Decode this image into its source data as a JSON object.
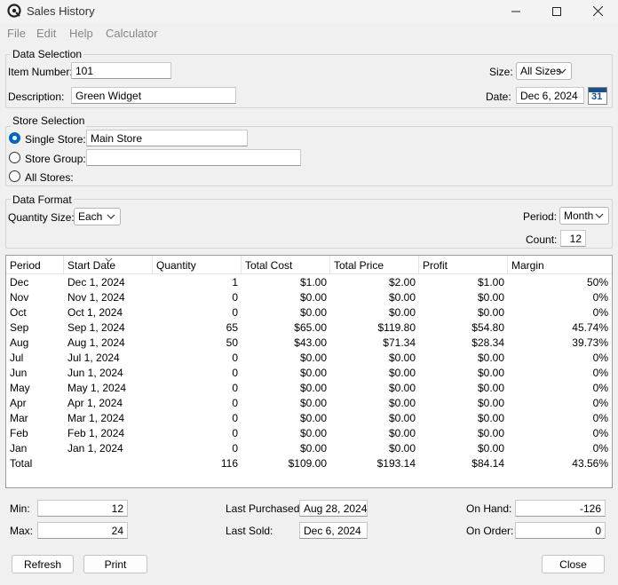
{
  "window": {
    "title": "Sales History",
    "minimize_icon": "minimize-icon",
    "maximize_icon": "maximize-icon",
    "close_icon": "close-icon"
  },
  "menu": [
    "File",
    "Edit",
    "Help",
    "Calculator"
  ],
  "data_selection": {
    "title": "Data Selection",
    "item_number_label": "Item Number:",
    "item_number": "101",
    "description_label": "Description:",
    "description": "Green Widget",
    "size_label": "Size:",
    "size": "All Sizes",
    "date_label": "Date:",
    "date": "Dec 6, 2024",
    "calendar_icon_text": "31"
  },
  "store_selection": {
    "title": "Store Selection",
    "single_store_label": "Single Store:",
    "single_store": "Main Store",
    "store_group_label": "Store Group:",
    "store_group": "",
    "all_stores_label": "All Stores:",
    "selected": "single"
  },
  "data_format": {
    "title": "Data Format",
    "quantity_size_label": "Quantity Size:",
    "quantity_size": "Each",
    "period_label": "Period:",
    "period": "Month",
    "count_label": "Count:",
    "count": "12"
  },
  "table": {
    "columns": [
      "Period",
      "Start Date",
      "Quantity",
      "Total Cost",
      "Total Price",
      "Profit",
      "Margin"
    ],
    "rows": [
      [
        "Dec",
        "Dec 1, 2024",
        "1",
        "$1.00",
        "$2.00",
        "$1.00",
        "50%"
      ],
      [
        "Nov",
        "Nov 1, 2024",
        "0",
        "$0.00",
        "$0.00",
        "$0.00",
        "0%"
      ],
      [
        "Oct",
        "Oct 1, 2024",
        "0",
        "$0.00",
        "$0.00",
        "$0.00",
        "0%"
      ],
      [
        "Sep",
        "Sep 1, 2024",
        "65",
        "$65.00",
        "$119.80",
        "$54.80",
        "45.74%"
      ],
      [
        "Aug",
        "Aug 1, 2024",
        "50",
        "$43.00",
        "$71.34",
        "$28.34",
        "39.73%"
      ],
      [
        "Jul",
        "Jul 1, 2024",
        "0",
        "$0.00",
        "$0.00",
        "$0.00",
        "0%"
      ],
      [
        "Jun",
        "Jun 1, 2024",
        "0",
        "$0.00",
        "$0.00",
        "$0.00",
        "0%"
      ],
      [
        "May",
        "May 1, 2024",
        "0",
        "$0.00",
        "$0.00",
        "$0.00",
        "0%"
      ],
      [
        "Apr",
        "Apr 1, 2024",
        "0",
        "$0.00",
        "$0.00",
        "$0.00",
        "0%"
      ],
      [
        "Mar",
        "Mar 1, 2024",
        "0",
        "$0.00",
        "$0.00",
        "$0.00",
        "0%"
      ],
      [
        "Feb",
        "Feb 1, 2024",
        "0",
        "$0.00",
        "$0.00",
        "$0.00",
        "0%"
      ],
      [
        "Jan",
        "Jan 1, 2024",
        "0",
        "$0.00",
        "$0.00",
        "$0.00",
        "0%"
      ],
      [
        "Total",
        "",
        "116",
        "$109.00",
        "$193.14",
        "$84.14",
        "43.56%"
      ]
    ]
  },
  "summary": {
    "min_label": "Min:",
    "min": "12",
    "max_label": "Max:",
    "max": "24",
    "last_purchased_label": "Last Purchased:",
    "last_purchased": "Aug 28, 2024",
    "last_sold_label": "Last Sold:",
    "last_sold": "Dec 6, 2024",
    "on_hand_label": "On Hand:",
    "on_hand": "-126",
    "on_order_label": "On Order:",
    "on_order": "0"
  },
  "buttons": {
    "refresh": "Refresh",
    "print": "Print",
    "close": "Close"
  },
  "colors": {
    "accent": "#0067c0",
    "background": "#f0f0f0"
  }
}
